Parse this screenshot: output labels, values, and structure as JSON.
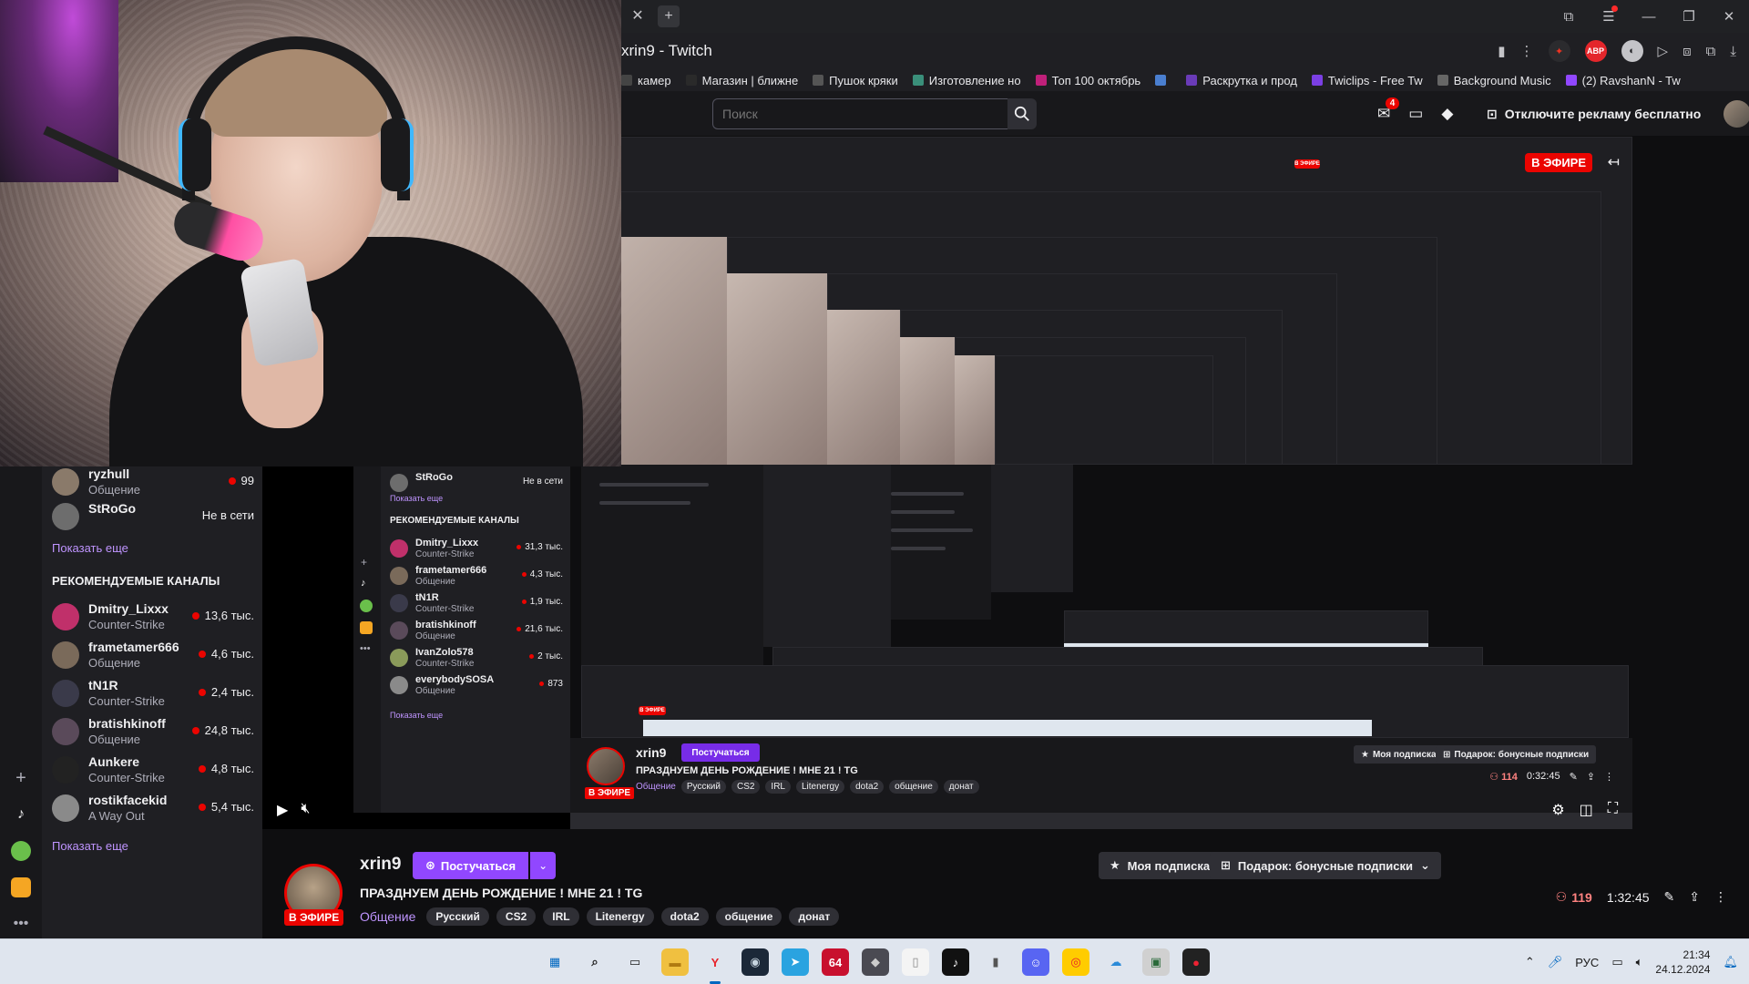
{
  "browser": {
    "page_title": "xrin9 - Twitch",
    "tab_close": "✕",
    "tab_new": "+"
  },
  "bookmarks": [
    {
      "label": "камер",
      "color": "#444"
    },
    {
      "label": "Магазин | ближне",
      "color": "#2a2a2a"
    },
    {
      "label": "Пушок кряки",
      "color": "#555"
    },
    {
      "label": "Изготовление но",
      "color": "#3a8f7a"
    },
    {
      "label": "Топ 100 октябрь",
      "color": "#c0207a"
    },
    {
      "label": "",
      "color": "#4a7fd0"
    },
    {
      "label": "Раскрутка и прод",
      "color": "#6a3bb8"
    },
    {
      "label": "Twiclips - Free Tw",
      "color": "#7b3fe4"
    },
    {
      "label": "Background Music",
      "color": "#666"
    },
    {
      "label": "(2) RavshanN - Tw",
      "color": "#9147ff"
    }
  ],
  "topnav": {
    "search_placeholder": "Поиск",
    "notif_count": "4",
    "adfree_label": "Отключите рекламу бесплатно"
  },
  "player": {
    "live_label": "В ЭФИРЕ"
  },
  "sidebar": {
    "followed": [
      {
        "name": "ryzhull",
        "category": "Общение",
        "viewers": "99",
        "live": true,
        "color": "#8a7a6a"
      },
      {
        "name": "StRoGo",
        "category": "",
        "status": "Не в сети",
        "live": false,
        "color": "#6d6d6d"
      }
    ],
    "show_more_1": "Показать еще",
    "recommended_header": "РЕКОМЕНДУЕМЫЕ КАНАЛЫ",
    "recommended": [
      {
        "name": "Dmitry_Lixxx",
        "category": "Counter-Strike",
        "viewers": "13,6 тыс.",
        "color": "#c0306a"
      },
      {
        "name": "frametamer666",
        "category": "Общение",
        "viewers": "4,6 тыс.",
        "color": "#7a6a5a"
      },
      {
        "name": "tN1R",
        "category": "Counter-Strike",
        "viewers": "2,4 тыс.",
        "color": "#3a3a4a"
      },
      {
        "name": "bratishkinoff",
        "category": "Общение",
        "viewers": "24,8 тыс.",
        "color": "#5a4a5a"
      },
      {
        "name": "Aunkere",
        "category": "Counter-Strike",
        "viewers": "4,8 тыс.",
        "color": "#222"
      },
      {
        "name": "rostikfacekid",
        "category": "A Way Out",
        "viewers": "5,4 тыс.",
        "color": "#8a8a8a"
      }
    ],
    "show_more_2": "Показать еще"
  },
  "inner_sidebar": {
    "followed": {
      "name": "StRoGo",
      "status": "Не в сети"
    },
    "show_more_1": "Показать еще",
    "recommended_header": "РЕКОМЕНДУЕМЫЕ КАНАЛЫ",
    "recommended": [
      {
        "name": "Dmitry_Lixxx",
        "category": "Counter-Strike",
        "viewers": "31,3 тыс."
      },
      {
        "name": "frametamer666",
        "category": "Общение",
        "viewers": "4,3 тыс."
      },
      {
        "name": "tN1R",
        "category": "Counter-Strike",
        "viewers": "1,9 тыс."
      },
      {
        "name": "bratishkinoff",
        "category": "Общение",
        "viewers": "21,6 тыс."
      },
      {
        "name": "IvanZolo578",
        "category": "Counter-Strike",
        "viewers": "2 тыс."
      },
      {
        "name": "everybodySOSA",
        "category": "Общение",
        "viewers": "873"
      }
    ],
    "show_more_2": "Показать еще"
  },
  "inner_info": {
    "name": "xrin9",
    "knock_label": "Постучаться",
    "title": "ПРАЗДНУЕМ ДЕНЬ РОЖДЕНИЕ ! МНЕ 21 ! TG",
    "category": "Общение",
    "tags": [
      "Русский",
      "CS2",
      "IRL",
      "Litenergy",
      "dota2",
      "общение",
      "донат"
    ],
    "live_label": "В ЭФИРЕ",
    "my_sub": "Моя подписка",
    "gift": "Подарок: бонусные подписки",
    "viewers": "114",
    "uptime": "0:32:45"
  },
  "channel": {
    "name": "xrin9",
    "knock_label": "Постучаться",
    "title": "ПРАЗДНУЕМ ДЕНЬ РОЖДЕНИЕ ! МНЕ 21 ! TG",
    "category": "Общение",
    "tags": [
      "Русский",
      "CS2",
      "IRL",
      "Litenergy",
      "dota2",
      "общение",
      "донат"
    ],
    "live_label": "В ЭФИРЕ",
    "my_sub_label": "Моя подписка",
    "gift_label": "Подарок: бонусные подписки",
    "viewers": "119",
    "uptime": "1:32:45"
  },
  "taskbar": {
    "lang": "РУС",
    "time": "21:34",
    "date": "24.12.2024",
    "apps": [
      {
        "name": "windows-start",
        "glyph": "▦",
        "bg": "transparent",
        "fg": "#0067c0"
      },
      {
        "name": "search",
        "glyph": "⌕",
        "bg": "transparent",
        "fg": "#1a1a1a"
      },
      {
        "name": "task-view",
        "glyph": "▭",
        "bg": "transparent",
        "fg": "#1a1a1a"
      },
      {
        "name": "file-explorer",
        "glyph": "▬",
        "bg": "#f0c040",
        "fg": "#b07a10"
      },
      {
        "name": "yandex-browser",
        "glyph": "Y",
        "bg": "transparent",
        "fg": "#e8222a"
      },
      {
        "name": "steam",
        "glyph": "◉",
        "bg": "#1b2838",
        "fg": "#c7d5e0"
      },
      {
        "name": "telegram",
        "glyph": "➤",
        "bg": "#2aa3e0",
        "fg": "#fff"
      },
      {
        "name": "app-64",
        "glyph": "64",
        "bg": "#c8102e",
        "fg": "#fff"
      },
      {
        "name": "cube-app",
        "glyph": "◆",
        "bg": "#4a4a52",
        "fg": "#ccc"
      },
      {
        "name": "document-app",
        "glyph": "▯",
        "bg": "#f4f4f4",
        "fg": "#888"
      },
      {
        "name": "tiktok",
        "glyph": "♪",
        "bg": "#111",
        "fg": "#fff"
      },
      {
        "name": "mouse-app",
        "glyph": "▮",
        "bg": "transparent",
        "fg": "#555"
      },
      {
        "name": "discord",
        "glyph": "☺",
        "bg": "#5865f2",
        "fg": "#fff"
      },
      {
        "name": "yandex-app",
        "glyph": "◎",
        "bg": "#ffcc00",
        "fg": "#e8222a"
      },
      {
        "name": "cloud-app",
        "glyph": "☁",
        "bg": "transparent",
        "fg": "#2a8ad8"
      },
      {
        "name": "monitor-app",
        "glyph": "▣",
        "bg": "#d0d0d0",
        "fg": "#2a6a3a"
      },
      {
        "name": "obs-app",
        "glyph": "●",
        "bg": "#222",
        "fg": "#e23"
      }
    ]
  }
}
